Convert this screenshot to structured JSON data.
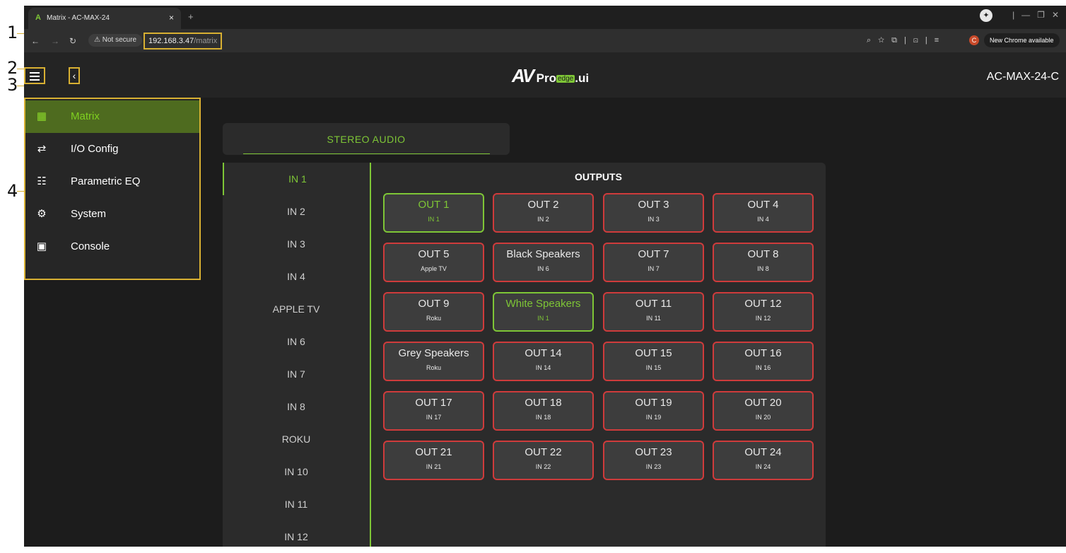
{
  "annotations": [
    "1",
    "2",
    "3",
    "4"
  ],
  "browser": {
    "tab_title": "Matrix - AC-MAX-24",
    "tab_close": "×",
    "new_tab": "+",
    "security": "Not secure",
    "url_host": "192.168.3.47",
    "url_path": "/matrix",
    "update_label": "New Chrome available",
    "profile_initial": "C"
  },
  "app": {
    "logo_av": "AV",
    "logo_pro": "Pro",
    "logo_edge": "edge",
    "logo_ui": ".ui",
    "device_name": "AC-MAX-24-C"
  },
  "sidebar": {
    "items": [
      {
        "label": "Matrix",
        "icon": "grid-icon"
      },
      {
        "label": "I/O Config",
        "icon": "swap-icon"
      },
      {
        "label": "Parametric EQ",
        "icon": "sliders-icon"
      },
      {
        "label": "System",
        "icon": "gear-icon"
      },
      {
        "label": "Console",
        "icon": "terminal-icon"
      }
    ]
  },
  "audio_tab": {
    "label": "STEREO AUDIO"
  },
  "inputs": [
    "IN 1",
    "IN 2",
    "IN 3",
    "IN 4",
    "APPLE TV",
    "IN 6",
    "IN 7",
    "IN 8",
    "ROKU",
    "IN 10",
    "IN 11",
    "IN 12"
  ],
  "outputs_title": "OUTPUTS",
  "outputs": [
    {
      "name": "OUT 1",
      "source": "IN 1",
      "active": true
    },
    {
      "name": "OUT 2",
      "source": "IN 2",
      "active": false
    },
    {
      "name": "OUT 3",
      "source": "IN 3",
      "active": false
    },
    {
      "name": "OUT 4",
      "source": "IN 4",
      "active": false
    },
    {
      "name": "OUT 5",
      "source": "Apple TV",
      "active": false
    },
    {
      "name": "Black Speakers",
      "source": "IN 6",
      "active": false
    },
    {
      "name": "OUT 7",
      "source": "IN 7",
      "active": false
    },
    {
      "name": "OUT 8",
      "source": "IN 8",
      "active": false
    },
    {
      "name": "OUT 9",
      "source": "Roku",
      "active": false
    },
    {
      "name": "White Speakers",
      "source": "IN 1",
      "active": true
    },
    {
      "name": "OUT 11",
      "source": "IN 11",
      "active": false
    },
    {
      "name": "OUT 12",
      "source": "IN 12",
      "active": false
    },
    {
      "name": "Grey Speakers",
      "source": "Roku",
      "active": false
    },
    {
      "name": "OUT 14",
      "source": "IN 14",
      "active": false
    },
    {
      "name": "OUT 15",
      "source": "IN 15",
      "active": false
    },
    {
      "name": "OUT 16",
      "source": "IN 16",
      "active": false
    },
    {
      "name": "OUT 17",
      "source": "IN 17",
      "active": false
    },
    {
      "name": "OUT 18",
      "source": "IN 18",
      "active": false
    },
    {
      "name": "OUT 19",
      "source": "IN 19",
      "active": false
    },
    {
      "name": "OUT 20",
      "source": "IN 20",
      "active": false
    },
    {
      "name": "OUT 21",
      "source": "IN 21",
      "active": false
    },
    {
      "name": "OUT 22",
      "source": "IN 22",
      "active": false
    },
    {
      "name": "OUT 23",
      "source": "IN 23",
      "active": false
    },
    {
      "name": "OUT 24",
      "source": "IN 24",
      "active": false
    }
  ],
  "colors": {
    "accent": "#7ec636",
    "unrouted_border": "#cf3b3b",
    "highlight": "#d8b032",
    "background": "#1c1c1c"
  }
}
